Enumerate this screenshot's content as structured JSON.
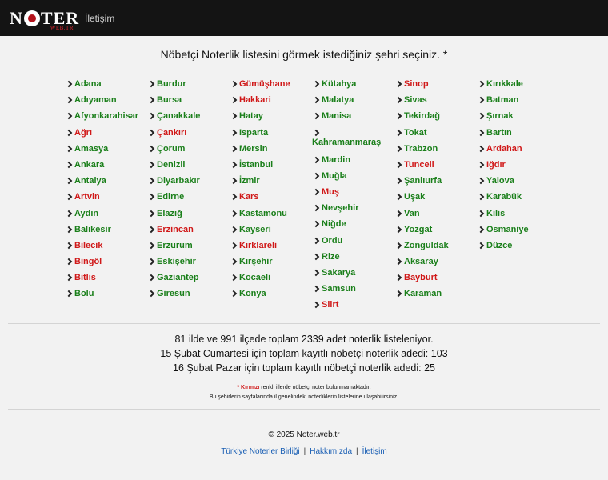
{
  "header": {
    "logo_main": "NTER",
    "logo_sub": "WEB.TR",
    "nav_contact": "İletişim"
  },
  "heading": "Nöbetçi Noterlik listesini görmek istediğiniz şehri seçiniz. *",
  "colors": {
    "available": "#1a7f1a",
    "unavailable": "#d01818",
    "link": "#1a5fb4"
  },
  "columns": [
    [
      {
        "name": "Adana",
        "status": "green"
      },
      {
        "name": "Adıyaman",
        "status": "green"
      },
      {
        "name": "Afyonkarahisar",
        "status": "green"
      },
      {
        "name": "Ağrı",
        "status": "red"
      },
      {
        "name": "Amasya",
        "status": "green"
      },
      {
        "name": "Ankara",
        "status": "green"
      },
      {
        "name": "Antalya",
        "status": "green"
      },
      {
        "name": "Artvin",
        "status": "red"
      },
      {
        "name": "Aydın",
        "status": "green"
      },
      {
        "name": "Balıkesir",
        "status": "green"
      },
      {
        "name": "Bilecik",
        "status": "red"
      },
      {
        "name": "Bingöl",
        "status": "red"
      },
      {
        "name": "Bitlis",
        "status": "red"
      },
      {
        "name": "Bolu",
        "status": "green"
      }
    ],
    [
      {
        "name": "Burdur",
        "status": "green"
      },
      {
        "name": "Bursa",
        "status": "green"
      },
      {
        "name": "Çanakkale",
        "status": "green"
      },
      {
        "name": "Çankırı",
        "status": "red"
      },
      {
        "name": "Çorum",
        "status": "green"
      },
      {
        "name": "Denizli",
        "status": "green"
      },
      {
        "name": "Diyarbakır",
        "status": "green"
      },
      {
        "name": "Edirne",
        "status": "green"
      },
      {
        "name": "Elazığ",
        "status": "green"
      },
      {
        "name": "Erzincan",
        "status": "red"
      },
      {
        "name": "Erzurum",
        "status": "green"
      },
      {
        "name": "Eskişehir",
        "status": "green"
      },
      {
        "name": "Gaziantep",
        "status": "green"
      },
      {
        "name": "Giresun",
        "status": "green"
      }
    ],
    [
      {
        "name": "Gümüşhane",
        "status": "red"
      },
      {
        "name": "Hakkari",
        "status": "red"
      },
      {
        "name": "Hatay",
        "status": "green"
      },
      {
        "name": "Isparta",
        "status": "green"
      },
      {
        "name": "Mersin",
        "status": "green"
      },
      {
        "name": "İstanbul",
        "status": "green"
      },
      {
        "name": "İzmir",
        "status": "green"
      },
      {
        "name": "Kars",
        "status": "red"
      },
      {
        "name": "Kastamonu",
        "status": "green"
      },
      {
        "name": "Kayseri",
        "status": "green"
      },
      {
        "name": "Kırklareli",
        "status": "red"
      },
      {
        "name": "Kırşehir",
        "status": "green"
      },
      {
        "name": "Kocaeli",
        "status": "green"
      },
      {
        "name": "Konya",
        "status": "green"
      }
    ],
    [
      {
        "name": "Kütahya",
        "status": "green"
      },
      {
        "name": "Malatya",
        "status": "green"
      },
      {
        "name": "Manisa",
        "status": "green"
      },
      {
        "name": "Kahramanmaraş",
        "status": "green",
        "wrap": true
      },
      {
        "name": "Mardin",
        "status": "green"
      },
      {
        "name": "Muğla",
        "status": "green"
      },
      {
        "name": "Muş",
        "status": "red"
      },
      {
        "name": "Nevşehir",
        "status": "green"
      },
      {
        "name": "Niğde",
        "status": "green"
      },
      {
        "name": "Ordu",
        "status": "green"
      },
      {
        "name": "Rize",
        "status": "green"
      },
      {
        "name": "Sakarya",
        "status": "green"
      },
      {
        "name": "Samsun",
        "status": "green"
      },
      {
        "name": "Siirt",
        "status": "red"
      }
    ],
    [
      {
        "name": "Sinop",
        "status": "red"
      },
      {
        "name": "Sivas",
        "status": "green"
      },
      {
        "name": "Tekirdağ",
        "status": "green"
      },
      {
        "name": "Tokat",
        "status": "green"
      },
      {
        "name": "Trabzon",
        "status": "green"
      },
      {
        "name": "Tunceli",
        "status": "red"
      },
      {
        "name": "Şanlıurfa",
        "status": "green"
      },
      {
        "name": "Uşak",
        "status": "green"
      },
      {
        "name": "Van",
        "status": "green"
      },
      {
        "name": "Yozgat",
        "status": "green"
      },
      {
        "name": "Zonguldak",
        "status": "green"
      },
      {
        "name": "Aksaray",
        "status": "green"
      },
      {
        "name": "Bayburt",
        "status": "red"
      },
      {
        "name": "Karaman",
        "status": "green"
      }
    ],
    [
      {
        "name": "Kırıkkale",
        "status": "green"
      },
      {
        "name": "Batman",
        "status": "green"
      },
      {
        "name": "Şırnak",
        "status": "green"
      },
      {
        "name": "Bartın",
        "status": "green"
      },
      {
        "name": "Ardahan",
        "status": "red"
      },
      {
        "name": "Iğdır",
        "status": "red"
      },
      {
        "name": "Yalova",
        "status": "green"
      },
      {
        "name": "Karabük",
        "status": "green"
      },
      {
        "name": "Kilis",
        "status": "green"
      },
      {
        "name": "Osmaniye",
        "status": "green"
      },
      {
        "name": "Düzce",
        "status": "green"
      }
    ]
  ],
  "stats": {
    "line1": "81 ilde ve 991 ilçede toplam 2339 adet noterlik listeleniyor.",
    "line2": "15 Şubat Cumartesi için toplam kayıtlı nöbetçi noterlik adedi: 103",
    "line3": "16 Şubat Pazar için toplam kayıtlı nöbetçi noterlik adedi: 25"
  },
  "notes": {
    "star_label": "* Kırmızı",
    "line1_rest": " renkli illerde nöbetçi noter bulunmamaktadır.",
    "line2": "Bu şehirlerin sayfalarında il genelindeki noterliklerin listelerine ulaşabilirsiniz."
  },
  "footer": {
    "copyright": "© 2025 Noter.web.tr",
    "link1": "Türkiye Noterler Birliği",
    "link2": "Hakkımızda",
    "link3": "İletişim",
    "separator": "|"
  }
}
